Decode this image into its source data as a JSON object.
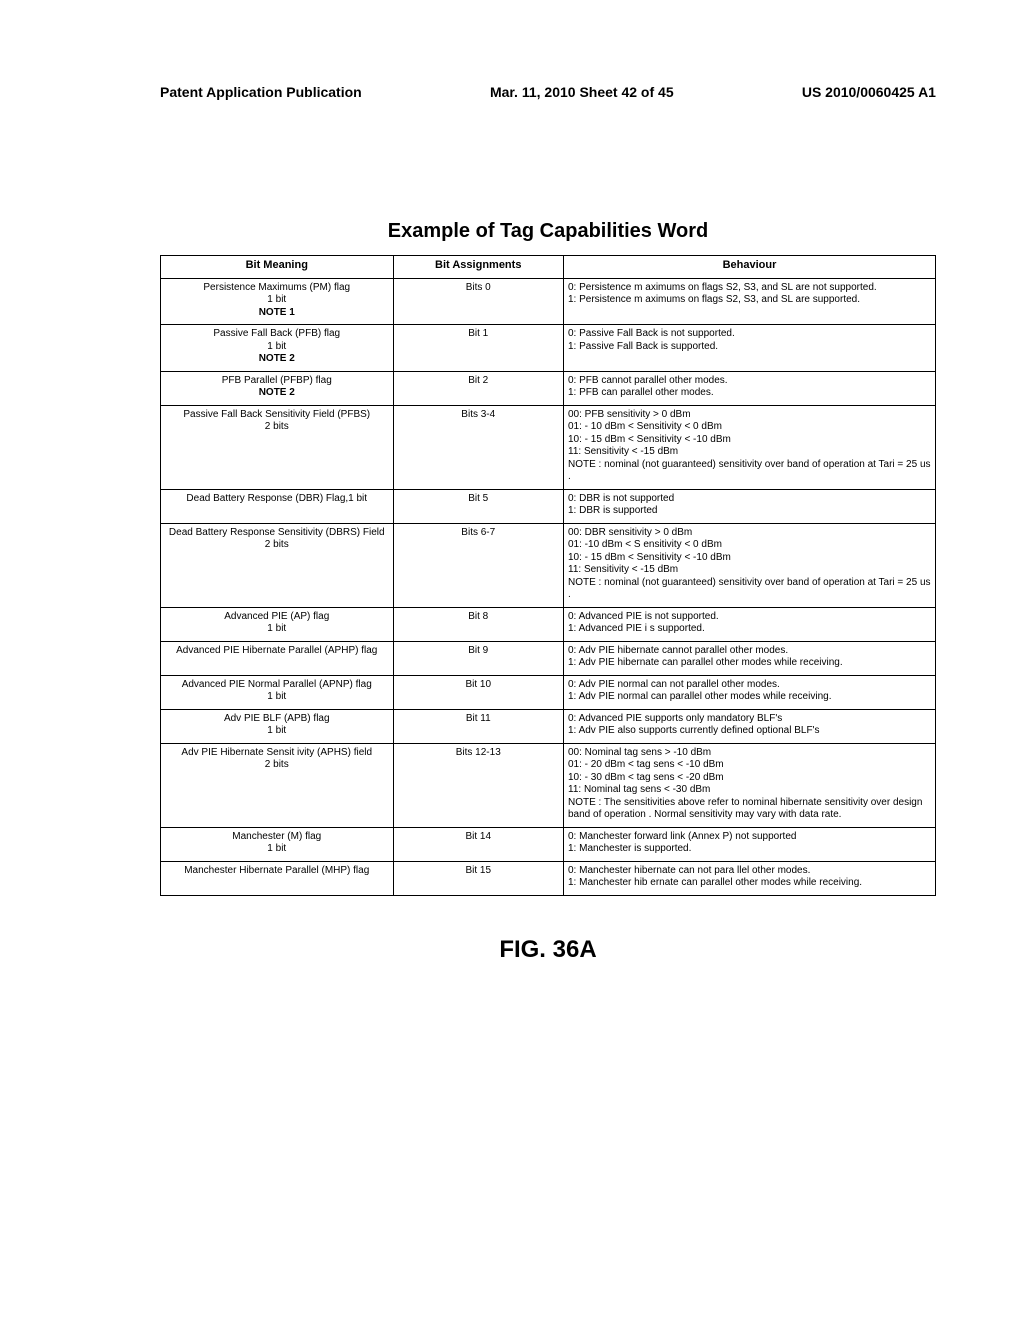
{
  "header": {
    "left": "Patent Application Publication",
    "mid": "Mar. 11, 2010  Sheet 42 of 45",
    "right": "US 2010/0060425 A1"
  },
  "title": "Example of Tag Capabilities Word",
  "table": {
    "headers": {
      "c1": "Bit Meaning",
      "c2": "Bit Assignments",
      "c3": "Behaviour"
    },
    "rows": [
      {
        "meaning": "Persistence Maximums (PM) flag\n1 bit\nNOTE 1",
        "note_last": true,
        "bits": "Bits 0",
        "beh": "0: Persistence m aximums on flags S2, S3, and SL are not supported.\n1: Persistence m aximums on flags S2, S3, and SL are supported."
      },
      {
        "meaning": "Passive Fall  Back (PFB) flag\n1 bit\nNOTE 2",
        "note_last": true,
        "bits": "Bit 1",
        "beh": "0:  Passive Fall Back is not supported.\n1:  Passive Fall Back is supported."
      },
      {
        "meaning": "PFB Parallel (PFBP) flag\nNOTE 2",
        "note_last": true,
        "bits": "Bit 2",
        "beh": "0:  PFB cannot parallel other modes.\n1:  PFB can parallel other modes."
      },
      {
        "meaning": "Passive Fall Back Sensitivity Field (PFBS)\n2 bits",
        "note_last": false,
        "bits": "Bits 3-4",
        "beh": "00:  PFB sensitivity > 0 dBm\n01: - 10 dBm < Sensitivity < 0 dBm\n10: - 15 dBm < Sensitivity <  -10 dBm\n11:  Sensitivity <  -15 dBm\nNOTE : nominal (not guaranteed) sensitivity over band of operation at Tari = 25 us ."
      },
      {
        "meaning": "Dead Battery Response (DBR) Flag,1 bit",
        "note_last": false,
        "bits": "Bit 5",
        "beh": "0:  DBR is not supported\n1:  DBR is supported"
      },
      {
        "meaning": "Dead Battery Response Sensitivity (DBRS) Field\n2 bits",
        "note_last": false,
        "bits": "Bits 6-7",
        "beh": "00:  DBR sensitivity > 0 dBm\n01: -10 dBm < S ensitivity < 0 dBm\n10: - 15 dBm < Sensitivity <  -10 dBm\n11:  Sensitivity <  -15 dBm\nNOTE : nominal (not guaranteed) sensitivity over band of operation at Tari = 25 us ."
      },
      {
        "meaning": "Advanced PIE (AP) flag\n1 bit",
        "note_last": false,
        "bits": "Bit 8",
        "beh": "0:  Advanced PIE is not supported.\n1:  Advanced PIE i s supported."
      },
      {
        "meaning": "Advanced PIE Hibernate Parallel (APHP) flag",
        "note_last": false,
        "bits": "Bit 9",
        "beh": "0:  Adv PIE hibernate cannot parallel other modes.\n1:  Adv PIE hibernate can parallel other modes  while receiving."
      },
      {
        "meaning": "Advanced PIE Normal Parallel (APNP) flag\n1 bit",
        "note_last": false,
        "bits": "Bit 10",
        "beh": "0:  Adv PIE normal can  not parallel other modes.\n1:  Adv PIE normal can parallel other modes  while receiving."
      },
      {
        "meaning": "Adv PIE BLF (APB) flag\n1 bit",
        "note_last": false,
        "bits": "Bit 11",
        "beh": " 0:  Advanced PIE supports only mandatory BLF's\n1:   Adv PIE also supports currently defined optional BLF's"
      },
      {
        "meaning": "Adv PIE Hibernate Sensit ivity (APHS) field\n2 bits",
        "note_last": false,
        "bits": "Bits 12-13",
        "beh": "00:  Nominal tag sens >  -10 dBm\n01: - 20 dBm < tag sens <  -10 dBm\n10: - 30 dBm < tag sens <  -20 dBm\n11:  Nominal tag sens <  -30 dBm\nNOTE :  The sensitivities above refer to nominal hibernate sensitivity  over design band of operation .  Normal sensitivity may vary with data rate."
      },
      {
        "meaning": "Manchester (M) flag\n1 bit",
        "note_last": false,
        "bits": "Bit 14",
        "beh": "0: Manchester forward link (Annex P) not supported\n1: Manchester is supported."
      },
      {
        "meaning": "Manchester Hibernate Parallel (MHP) flag",
        "note_last": false,
        "bits": "Bit 15",
        "beh": "0:  Manchester hibernate can  not para llel other modes.\n1:  Manchester hib ernate can parallel other modes while receiving."
      }
    ]
  },
  "figure": "FIG. 36A"
}
